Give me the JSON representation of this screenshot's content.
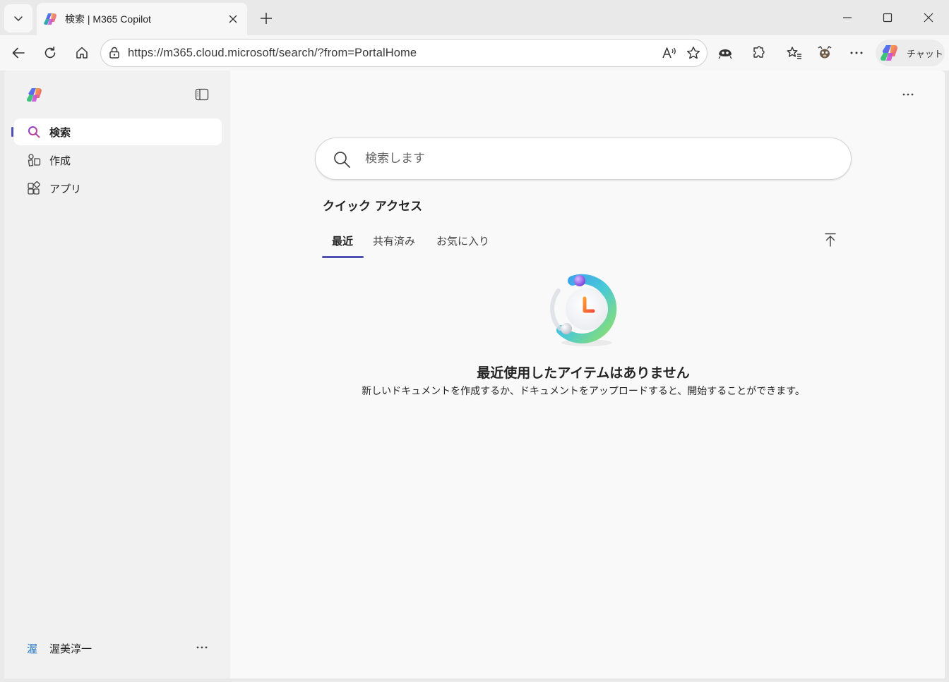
{
  "browser": {
    "tab": {
      "title": "検索 | M365 Copilot"
    },
    "address": {
      "url": "https://m365.cloud.microsoft/search/?from=PortalHome"
    },
    "copilot_chat_label": "チャット",
    "icons": [
      "tab-menu-icon",
      "copilot-favicon",
      "close-icon",
      "plus-icon",
      "minimize-icon",
      "maximize-icon",
      "window-close-icon",
      "back-icon",
      "refresh-icon",
      "home-icon",
      "site-info-icon",
      "read-aloud-icon",
      "favorite-star-icon",
      "extension-icon",
      "puzzle-icon",
      "favorites-icon",
      "profile-icon",
      "more-icon",
      "copilot-icon"
    ]
  },
  "sidebar": {
    "items": [
      {
        "label": "検索",
        "icon": "search-icon",
        "active": true
      },
      {
        "label": "作成",
        "icon": "create-icon",
        "active": false
      },
      {
        "label": "アプリ",
        "icon": "apps-icon",
        "active": false
      }
    ],
    "user": {
      "avatar_text": "渥",
      "name": "渥美淳一"
    }
  },
  "main": {
    "search": {
      "placeholder": "検索します"
    },
    "quick_access": {
      "title": "クイック アクセス",
      "tabs": [
        {
          "label": "最近",
          "active": true
        },
        {
          "label": "共有済み",
          "active": false
        },
        {
          "label": "お気に入り",
          "active": false
        }
      ]
    },
    "empty_state": {
      "title": "最近使用したアイテムはありません",
      "subtitle": "新しいドキュメントを作成するか、ドキュメントをアップロードすると、開始することができます。"
    }
  },
  "colors": {
    "accent": "#4f52b2",
    "page_bg": "#f9f9f9",
    "sidebar_bg": "#f1f1f1",
    "chrome_bg": "#e9e9e9"
  }
}
